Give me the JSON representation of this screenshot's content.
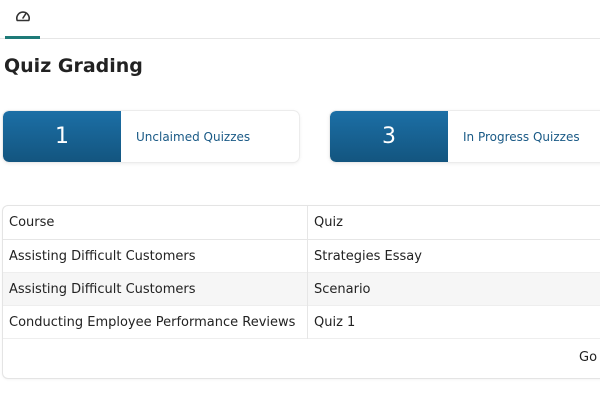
{
  "tabs": [
    {
      "icon": "gauge-icon",
      "active": true
    }
  ],
  "colors": {
    "accent": "#1e7a78",
    "card_blue": "#1c6fa6",
    "link_blue": "#1a5a86"
  },
  "page": {
    "title": "Quiz Grading"
  },
  "stats": [
    {
      "count": "1",
      "label": "Unclaimed Quizzes"
    },
    {
      "count": "3",
      "label": "In Progress Quizzes"
    }
  ],
  "table": {
    "columns": [
      "Course",
      "Quiz"
    ],
    "rows": [
      {
        "course": "Assisting Difficult Customers",
        "quiz": "Strategies Essay"
      },
      {
        "course": "Assisting Difficult Customers",
        "quiz": "Scenario"
      },
      {
        "course": "Conducting Employee Performance Reviews",
        "quiz": "Quiz 1"
      }
    ]
  },
  "footer": {
    "go_label": "Go"
  }
}
